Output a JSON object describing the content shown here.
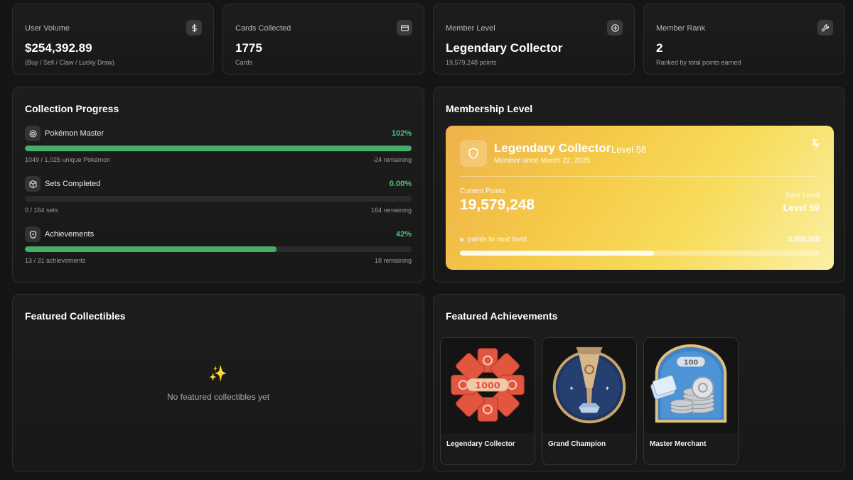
{
  "stats": [
    {
      "label": "User Volume",
      "value": "$254,392.89",
      "sub": "(Buy / Sell / Claw / Lucky Draw)",
      "icon": "dollar-icon"
    },
    {
      "label": "Cards Collected",
      "value": "1775",
      "sub": "Cards",
      "icon": "card-icon"
    },
    {
      "label": "Member Level",
      "value": "Legendary Collector",
      "sub": "19,579,248 points",
      "icon": "plus-circle-icon"
    },
    {
      "label": "Member Rank",
      "value": "2",
      "sub": "Ranked by total points earned",
      "icon": "wrench-icon"
    }
  ],
  "collection": {
    "title": "Collection Progress",
    "items": [
      {
        "name": "Pokémon Master",
        "pct": "102%",
        "fraction": 1.0,
        "foot": "1049 / 1,025 unique Pokémon",
        "remaining": "-24 remaining",
        "icon": "target-icon"
      },
      {
        "name": "Sets Completed",
        "pct": "0.00%",
        "fraction": 0.0,
        "foot": "0 / 164 sets",
        "remaining": "164 remaining",
        "icon": "box-icon"
      },
      {
        "name": "Achievements",
        "pct": "42%",
        "fraction": 0.65,
        "foot": "13 / 31 achievements",
        "remaining": "18 remaining",
        "icon": "badge-icon"
      }
    ]
  },
  "membership": {
    "title": "Membership Level",
    "level_name": "Legendary Collector",
    "level": "Level 58",
    "since": "Member since March 22, 2025",
    "current_label": "Current Points",
    "current_value": "19,579,248",
    "next_label": "Next Level",
    "next_value": "Level 59",
    "points_label": "points to next level",
    "points_value": "3,898,368",
    "progress": 0.54
  },
  "collectibles": {
    "title": "Featured Collectibles",
    "empty_icon": "✨",
    "empty_text": "No featured collectibles yet"
  },
  "achievements": {
    "title": "Featured Achievements",
    "items": [
      {
        "name": "Legendary Collector",
        "icon": "collector-badge-icon"
      },
      {
        "name": "Grand Champion",
        "icon": "trophy-icon"
      },
      {
        "name": "Master Merchant",
        "icon": "coins-icon"
      }
    ]
  },
  "colors": {
    "accent_green": "#46ad6a",
    "pct_green": "#4fc47d",
    "gold": "#f5ca47"
  }
}
